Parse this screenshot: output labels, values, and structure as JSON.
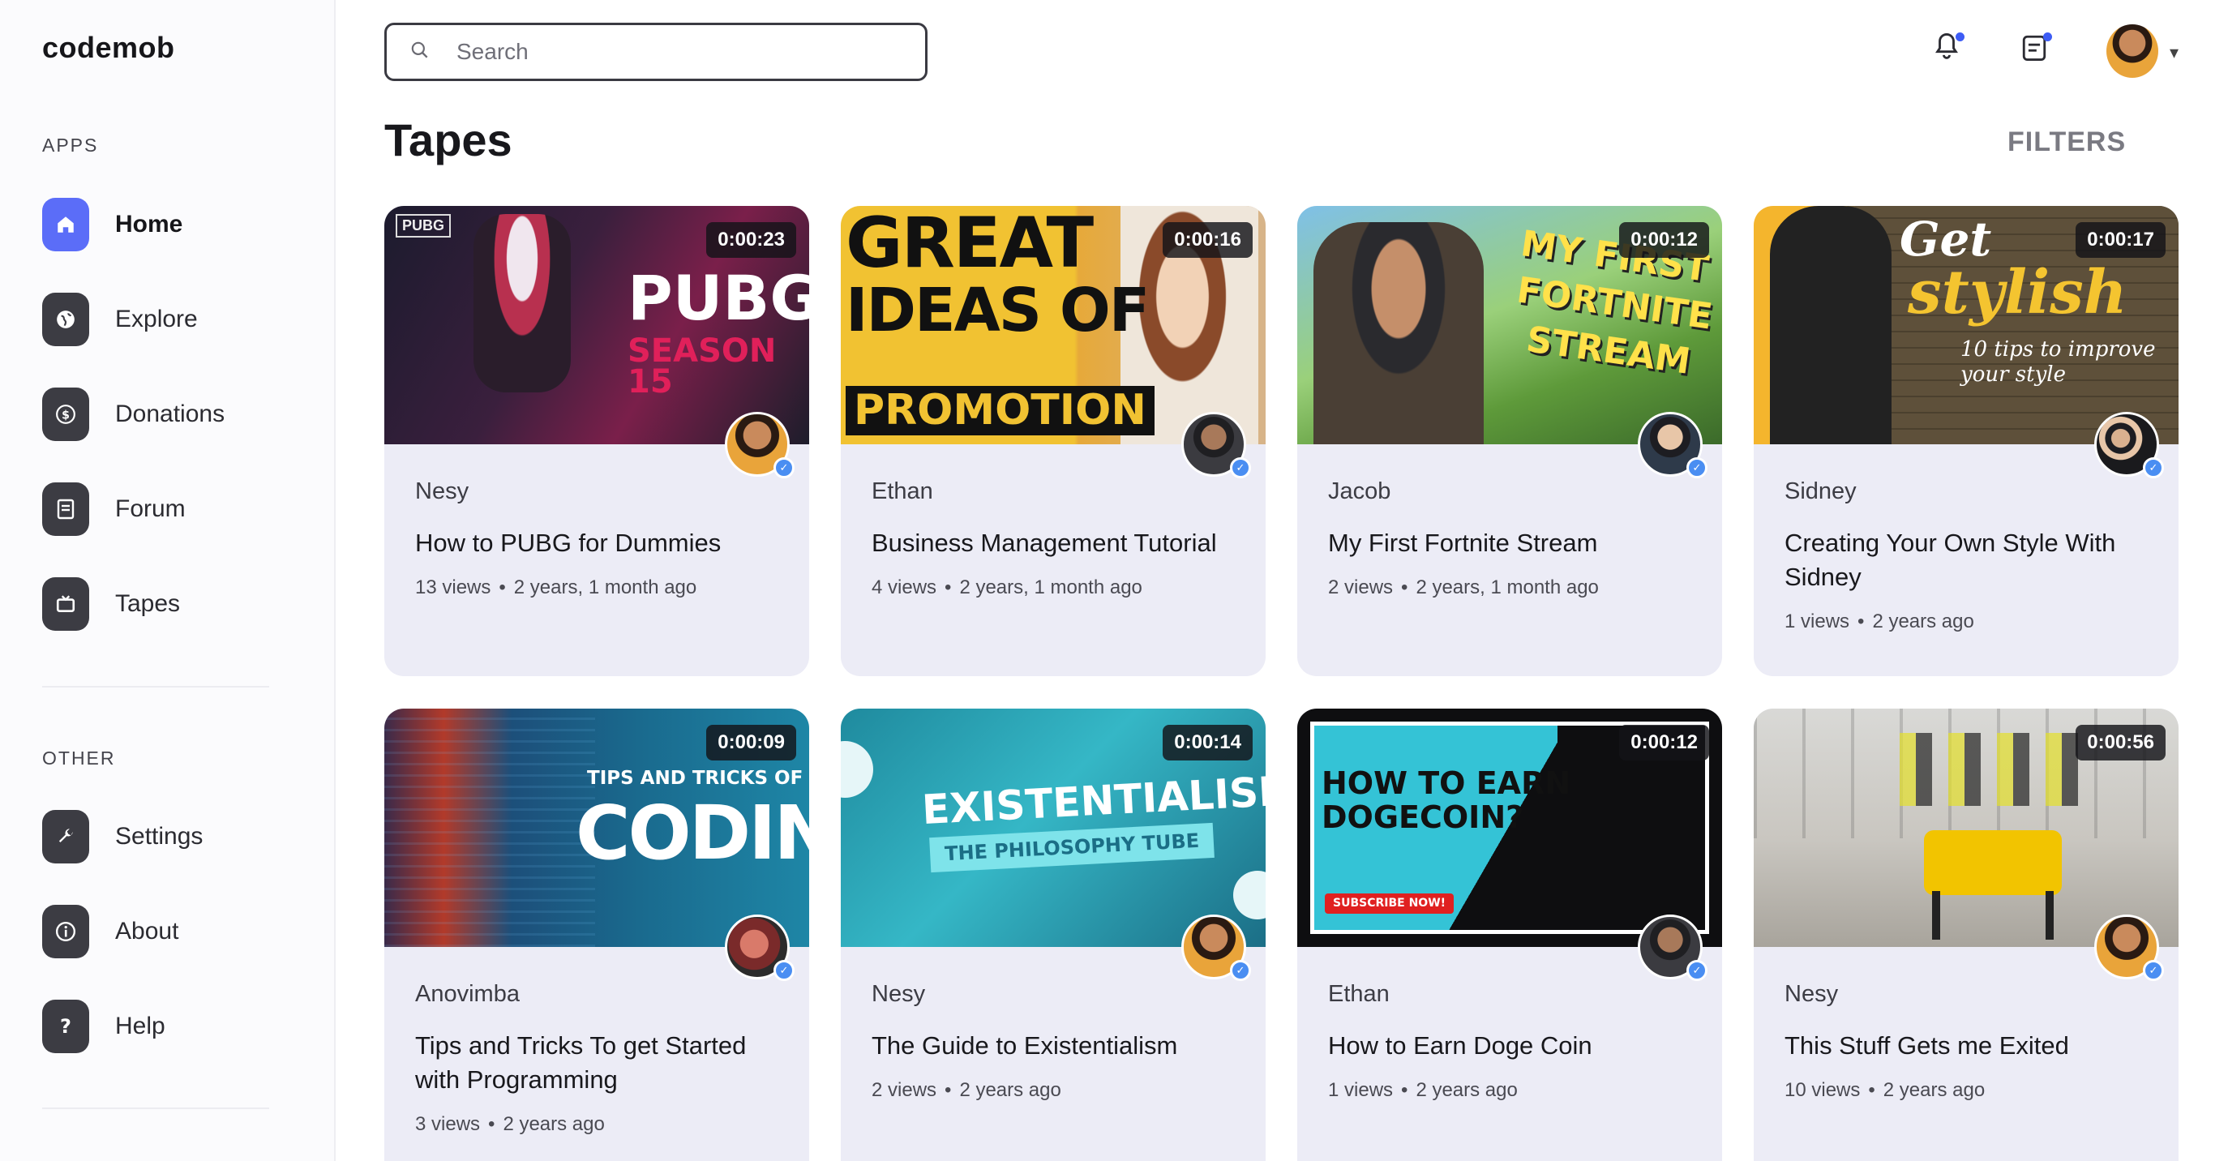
{
  "brand": "codemob",
  "sidebar": {
    "apps_label": "APPS",
    "other_label": "OTHER",
    "apps": [
      {
        "label": "Home",
        "icon": "home-icon",
        "active": true
      },
      {
        "label": "Explore",
        "icon": "globe-icon",
        "active": false
      },
      {
        "label": "Donations",
        "icon": "dollar-icon",
        "active": false
      },
      {
        "label": "Forum",
        "icon": "forum-icon",
        "active": false
      },
      {
        "label": "Tapes",
        "icon": "tv-icon",
        "active": false
      }
    ],
    "other": [
      {
        "label": "Settings",
        "icon": "wrench-icon"
      },
      {
        "label": "About",
        "icon": "info-icon"
      },
      {
        "label": "Help",
        "icon": "question-icon"
      }
    ]
  },
  "search": {
    "placeholder": "Search",
    "value": ""
  },
  "header": {
    "title": "Tapes",
    "filters": "FILTERS"
  },
  "cards": [
    {
      "creator": "Nesy",
      "title": "How to PUBG for Dummies",
      "views": "13 views",
      "age": "2 years, 1 month ago",
      "duration": "0:00:23"
    },
    {
      "creator": "Ethan",
      "title": "Business Management Tutorial",
      "views": "4 views",
      "age": "2 years, 1 month ago",
      "duration": "0:00:16"
    },
    {
      "creator": "Jacob",
      "title": "My First Fortnite Stream",
      "views": "2 views",
      "age": "2 years, 1 month ago",
      "duration": "0:00:12"
    },
    {
      "creator": "Sidney",
      "title": "Creating Your Own Style With Sidney",
      "views": "1 views",
      "age": "2 years ago",
      "duration": "0:00:17"
    },
    {
      "creator": "Anovimba",
      "title": "Tips and Tricks To get Started with Programming",
      "views": "3 views",
      "age": "2 years ago",
      "duration": "0:00:09"
    },
    {
      "creator": "Nesy",
      "title": "The Guide to Existentialism",
      "views": "2 views",
      "age": "2 years ago",
      "duration": "0:00:14"
    },
    {
      "creator": "Ethan",
      "title": "How to Earn Doge Coin",
      "views": "1 views",
      "age": "2 years ago",
      "duration": "0:00:12"
    },
    {
      "creator": "Nesy",
      "title": "This Stuff Gets me Exited",
      "views": "10 views",
      "age": "2 years ago",
      "duration": "0:00:56"
    }
  ],
  "thumbnails": [
    {
      "lines": [
        "PUBG",
        "SEASON 15"
      ]
    },
    {
      "lines": [
        "GREAT",
        "IDEAS OF",
        "PROMOTION"
      ]
    },
    {
      "lines": [
        "MY FIRST",
        "FORTNITE",
        "STREAM"
      ]
    },
    {
      "lines": [
        "Get",
        "stylish",
        "10 tips to improve your style"
      ]
    },
    {
      "lines": [
        "TIPS AND TRICKS OF",
        "CODING"
      ]
    },
    {
      "lines": [
        "EXISTENTIALISM",
        "THE PHILOSOPHY TUBE"
      ]
    },
    {
      "lines": [
        "HOW TO EARN",
        "DOGECOIN?",
        "SUBSCRIBE NOW!"
      ]
    },
    {
      "lines": []
    }
  ],
  "colors": {
    "accent": "#5b6df8",
    "verified": "#4a8ef2",
    "card_bg": "#ececf6"
  }
}
